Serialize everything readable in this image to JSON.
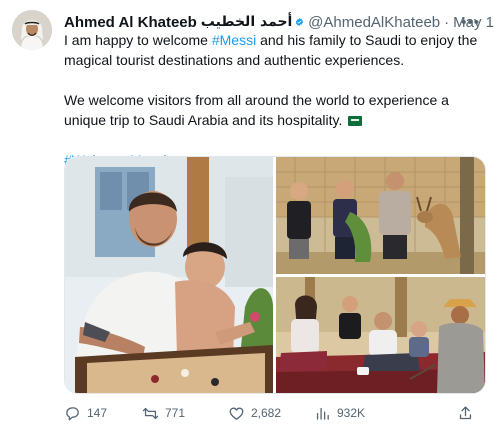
{
  "author": {
    "name": "Ahmed Al Khateeb",
    "name_arabic": "أحمد الخطيب",
    "handle": "@AhmedAlKhateeb",
    "date": "May 1",
    "verified": true,
    "avatar_icon": "profile-photo"
  },
  "tweet": {
    "line1_pre": "I am happy to welcome ",
    "mention": "#Messi",
    "line1_post": " and his family to Saudi to enjoy the magical tourist destinations and authentic experiences.",
    "line2": "We welcome visitors from all around the world to experience a unique trip to Saudi Arabia and its hospitality.",
    "flag": "saudi-flag-icon",
    "hashtag": "#WelcomeMessi"
  },
  "media": {
    "photos": [
      "messi-playing-carrom-with-son",
      "boys-feeding-deer",
      "family-sitting-with-guide"
    ]
  },
  "stats": {
    "replies": "147",
    "retweets": "771",
    "likes": "2,682",
    "views": "932K"
  },
  "colors": {
    "link": "#1d9bf0",
    "verified": "#1d9bf0",
    "secondary_text": "#536471"
  }
}
